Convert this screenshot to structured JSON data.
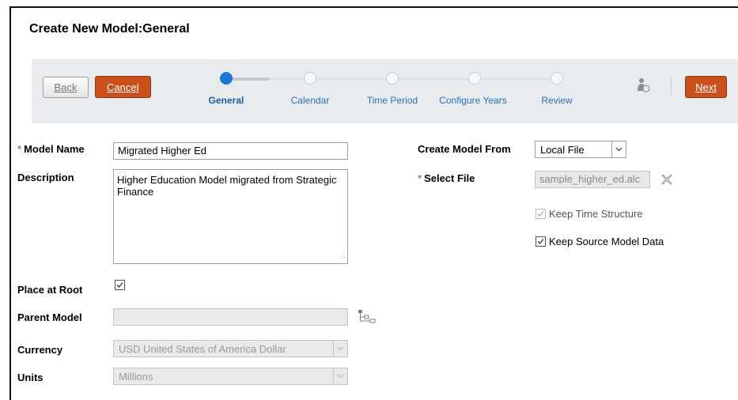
{
  "page": {
    "title": "Create New Model:General"
  },
  "toolbar": {
    "back_label": "Back",
    "cancel_label": "Cancel",
    "next_label": "Next"
  },
  "train": {
    "steps": [
      {
        "label": "General",
        "current": true
      },
      {
        "label": "Calendar",
        "current": false
      },
      {
        "label": "Time Period",
        "current": false
      },
      {
        "label": "Configure Years",
        "current": false
      },
      {
        "label": "Review",
        "current": false
      }
    ]
  },
  "form": {
    "model_name": {
      "label": "Model Name",
      "required_mark": "*",
      "value": "Migrated Higher Ed"
    },
    "description": {
      "label": "Description",
      "value": "Higher Education Model migrated from Strategic Finance"
    },
    "place_at_root": {
      "label": "Place at Root",
      "checked": true
    },
    "parent_model": {
      "label": "Parent Model",
      "value": ""
    },
    "currency": {
      "label": "Currency",
      "value": "USD United States of America Dollar"
    },
    "units": {
      "label": "Units",
      "value": "Millions"
    },
    "create_model_from": {
      "label": "Create Model From",
      "value": "Local File"
    },
    "select_file": {
      "label": "Select File",
      "required_mark": "*",
      "value": "sample_higher_ed.alc"
    },
    "keep_time_structure": {
      "label": "Keep Time Structure",
      "checked": true,
      "disabled": true
    },
    "keep_source_model_data": {
      "label": "Keep Source Model Data",
      "checked": true
    }
  },
  "icons": {
    "help": "user-help-icon",
    "clear": "clear-x-icon",
    "hierarchy": "hierarchy-tree-icon",
    "checkmark": "check-icon",
    "dropdown": "chevron-down-icon"
  },
  "colors": {
    "action_orange": "#c9501a",
    "train_current": "#1d77d3",
    "train_link": "#2a6db5",
    "bar_bg": "#e8ecef"
  }
}
